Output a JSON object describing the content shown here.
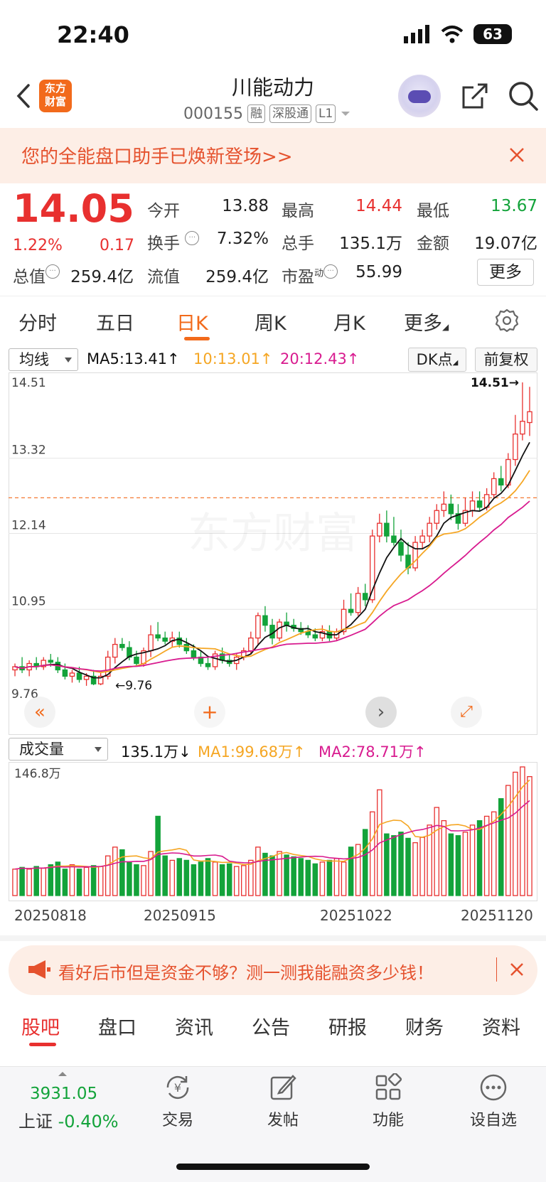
{
  "status_bar": {
    "time": "22:40",
    "battery": "63"
  },
  "header": {
    "logo_line1": "东方",
    "logo_line2": "财富",
    "title": "川能动力",
    "code": "000155",
    "tags": [
      "融",
      "深股通",
      "L1"
    ]
  },
  "banner": {
    "text": "您的全能盘口助手已焕新登场>>"
  },
  "quote": {
    "price": "14.05",
    "change_pct": "1.22%",
    "change": "0.17",
    "fields": [
      {
        "label": "今开",
        "value": "13.88"
      },
      {
        "label": "最高",
        "value": "14.44"
      },
      {
        "label": "最低",
        "value": "13.67"
      },
      {
        "label": "换手",
        "value": "7.32%"
      },
      {
        "label": "总手",
        "value": "135.1万"
      },
      {
        "label": "金额",
        "value": "19.07亿"
      },
      {
        "label": "总值",
        "value": "259.4亿"
      },
      {
        "label": "流值",
        "value": "259.4亿"
      },
      {
        "label": "市盈",
        "value": "55.99"
      }
    ],
    "pe_sup": "动",
    "more": "更多"
  },
  "chart_tabs": [
    "分时",
    "五日",
    "日K",
    "周K",
    "月K",
    "更多"
  ],
  "ma_row": {
    "select": "均线",
    "ma5": "MA5:13.41↑",
    "ma10": "10:13.01↑",
    "ma20": "20:12.43↑",
    "dk": "DK点",
    "fq": "前复权"
  },
  "colors": {
    "up": "#e8302f",
    "down": "#13a33a",
    "ma5": "#111111",
    "ma10": "#f5a623",
    "ma20": "#d81b8f",
    "accent": "#f26a1b"
  },
  "chart_data": {
    "type": "candlestick",
    "y_ticks": [
      "14.51",
      "13.32",
      "12.14",
      "10.95",
      "9.76"
    ],
    "ylim": [
      9.76,
      14.51
    ],
    "low_marker": "9.76",
    "high_marker": "14.51",
    "current_price_line": 12.7,
    "x_labels": [
      "20250818",
      "20250915",
      "20251022",
      "20251120"
    ],
    "candles": [
      [
        10.0,
        10.05,
        9.95,
        10.1,
        9.9
      ],
      [
        10.05,
        10.0,
        10.1,
        10.2,
        9.95
      ],
      [
        10.0,
        10.1,
        9.95,
        10.15,
        9.9
      ],
      [
        10.1,
        10.05,
        10.15,
        10.2,
        10.0
      ],
      [
        10.05,
        10.15,
        10.0,
        10.2,
        10.0
      ],
      [
        10.15,
        10.12,
        10.2,
        10.25,
        10.05
      ],
      [
        10.12,
        10.0,
        10.15,
        10.2,
        9.95
      ],
      [
        10.0,
        9.9,
        10.05,
        10.1,
        9.85
      ],
      [
        9.9,
        9.95,
        9.85,
        10.0,
        9.8
      ],
      [
        9.95,
        9.85,
        10.0,
        10.05,
        9.8
      ],
      [
        9.85,
        9.9,
        9.8,
        9.95,
        9.75
      ],
      [
        9.9,
        9.78,
        9.95,
        10.0,
        9.76
      ],
      [
        9.78,
        9.9,
        9.8,
        9.95,
        9.76
      ],
      [
        9.9,
        10.2,
        9.95,
        10.3,
        9.85
      ],
      [
        10.2,
        10.4,
        10.2,
        10.5,
        10.1
      ],
      [
        10.4,
        10.35,
        10.45,
        10.5,
        10.3
      ],
      [
        10.35,
        10.2,
        10.4,
        10.45,
        10.15
      ],
      [
        10.2,
        10.1,
        10.25,
        10.3,
        10.05
      ],
      [
        10.1,
        10.3,
        10.1,
        10.35,
        10.05
      ],
      [
        10.3,
        10.55,
        10.3,
        10.7,
        10.2
      ],
      [
        10.55,
        10.5,
        10.6,
        10.75,
        10.45
      ],
      [
        10.5,
        10.45,
        10.55,
        10.6,
        10.4
      ],
      [
        10.45,
        10.5,
        10.4,
        10.6,
        10.35
      ],
      [
        10.5,
        10.4,
        10.55,
        10.6,
        10.35
      ],
      [
        10.4,
        10.3,
        10.45,
        10.5,
        10.25
      ],
      [
        10.3,
        10.2,
        10.35,
        10.4,
        10.15
      ],
      [
        10.2,
        10.1,
        10.25,
        10.3,
        10.05
      ],
      [
        10.1,
        10.05,
        10.15,
        10.2,
        10.0
      ],
      [
        10.05,
        10.25,
        10.05,
        10.3,
        10.0
      ],
      [
        10.25,
        10.15,
        10.3,
        10.35,
        10.1
      ],
      [
        10.15,
        10.1,
        10.2,
        10.25,
        10.05
      ],
      [
        10.1,
        10.2,
        10.05,
        10.25,
        10.0
      ],
      [
        10.2,
        10.3,
        10.2,
        10.35,
        10.15
      ],
      [
        10.3,
        10.5,
        10.3,
        10.6,
        10.25
      ],
      [
        10.5,
        10.85,
        10.5,
        10.9,
        10.4
      ],
      [
        10.85,
        10.7,
        10.9,
        11.0,
        10.6
      ],
      [
        10.7,
        10.5,
        10.75,
        10.8,
        10.4
      ],
      [
        10.5,
        10.75,
        10.55,
        10.8,
        10.45
      ],
      [
        10.75,
        10.7,
        10.8,
        10.9,
        10.6
      ],
      [
        10.7,
        10.65,
        10.75,
        10.8,
        10.6
      ],
      [
        10.65,
        10.6,
        10.7,
        10.75,
        10.55
      ],
      [
        10.6,
        10.55,
        10.65,
        10.7,
        10.5
      ],
      [
        10.55,
        10.5,
        10.6,
        10.65,
        10.45
      ],
      [
        10.5,
        10.6,
        10.55,
        10.7,
        10.45
      ],
      [
        10.6,
        10.5,
        10.65,
        10.7,
        10.45
      ],
      [
        10.5,
        10.6,
        10.5,
        10.65,
        10.45
      ],
      [
        10.6,
        10.95,
        10.6,
        11.1,
        10.55
      ],
      [
        10.95,
        10.9,
        11.0,
        11.2,
        10.85
      ],
      [
        10.9,
        11.2,
        10.95,
        11.3,
        10.85
      ],
      [
        11.2,
        11.1,
        11.3,
        11.35,
        11.0
      ],
      [
        11.1,
        12.1,
        11.1,
        12.2,
        11.05
      ],
      [
        12.1,
        12.3,
        12.15,
        12.45,
        12.0
      ],
      [
        12.3,
        12.1,
        12.35,
        12.5,
        12.0
      ],
      [
        12.1,
        12.0,
        12.2,
        12.4,
        11.95
      ],
      [
        12.0,
        11.8,
        12.05,
        12.2,
        11.7
      ],
      [
        11.8,
        11.6,
        11.85,
        12.0,
        11.5
      ],
      [
        11.6,
        12.0,
        11.65,
        12.1,
        11.55
      ],
      [
        12.0,
        12.1,
        12.05,
        12.2,
        11.9
      ],
      [
        12.1,
        12.3,
        12.05,
        12.4,
        12.0
      ],
      [
        12.3,
        12.5,
        12.3,
        12.6,
        12.2
      ],
      [
        12.5,
        12.6,
        12.45,
        12.8,
        12.4
      ],
      [
        12.6,
        12.45,
        12.65,
        12.75,
        12.35
      ],
      [
        12.45,
        12.3,
        12.5,
        12.6,
        12.2
      ],
      [
        12.3,
        12.5,
        12.35,
        12.7,
        12.25
      ],
      [
        12.5,
        12.65,
        12.45,
        12.8,
        12.4
      ],
      [
        12.65,
        12.55,
        12.7,
        12.8,
        12.5
      ],
      [
        12.55,
        12.75,
        12.5,
        12.85,
        12.5
      ],
      [
        12.75,
        13.0,
        12.8,
        13.1,
        12.7
      ],
      [
        13.0,
        12.9,
        13.05,
        13.2,
        12.8
      ],
      [
        12.9,
        13.3,
        12.95,
        13.4,
        12.85
      ],
      [
        13.3,
        13.7,
        13.35,
        14.0,
        13.2
      ],
      [
        13.7,
        13.9,
        13.75,
        14.51,
        13.6
      ],
      [
        13.88,
        14.05,
        13.88,
        14.44,
        13.67
      ]
    ],
    "ma5_label": "MA5",
    "ma10_label": "10",
    "ma20_label": "20"
  },
  "volume_row": {
    "select": "成交量",
    "total": "135.1万↓",
    "ma1": "MA1:99.68万↑",
    "ma2": "MA2:78.71万↑",
    "max_label": "146.8万"
  },
  "volume_data": [
    30,
    32,
    30,
    33,
    31,
    35,
    38,
    30,
    35,
    30,
    32,
    34,
    33,
    45,
    55,
    52,
    38,
    35,
    34,
    50,
    90,
    45,
    40,
    42,
    40,
    35,
    38,
    42,
    38,
    35,
    36,
    33,
    34,
    40,
    55,
    48,
    45,
    50,
    46,
    44,
    42,
    40,
    36,
    38,
    40,
    42,
    38,
    55,
    58,
    75,
    95,
    120,
    70,
    68,
    72,
    65,
    60,
    66,
    80,
    100,
    85,
    70,
    68,
    72,
    80,
    85,
    90,
    95,
    110,
    125,
    140,
    146,
    135
  ],
  "promo": {
    "text": "看好后市但是资金不够？测一测我能融资多少钱！"
  },
  "bottom_tabs": [
    "股吧",
    "盘口",
    "资讯",
    "公告",
    "研报",
    "财务",
    "资料"
  ],
  "footer": {
    "index_value": "3931.05",
    "index_name": "上证",
    "index_change": "-0.40%",
    "tabs": [
      {
        "label": "交易",
        "icon": "yuan-exchange-icon"
      },
      {
        "label": "发帖",
        "icon": "edit-post-icon"
      },
      {
        "label": "功能",
        "icon": "grid-apps-icon"
      },
      {
        "label": "设自选",
        "icon": "more-dots-icon"
      }
    ]
  }
}
